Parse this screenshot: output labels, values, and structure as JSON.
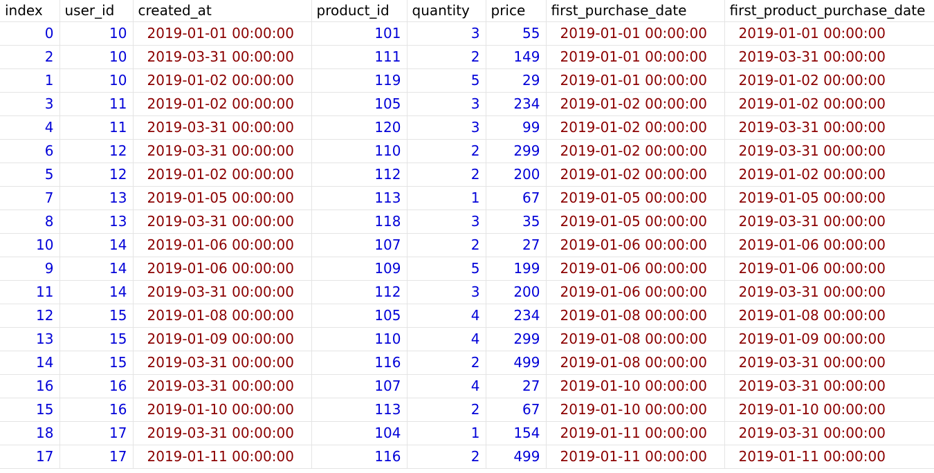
{
  "columns": [
    {
      "key": "index",
      "label": "index",
      "type": "num"
    },
    {
      "key": "user_id",
      "label": "user_id",
      "type": "num"
    },
    {
      "key": "created_at",
      "label": "created_at",
      "type": "date"
    },
    {
      "key": "product_id",
      "label": "product_id",
      "type": "num"
    },
    {
      "key": "quantity",
      "label": "quantity",
      "type": "num"
    },
    {
      "key": "price",
      "label": "price",
      "type": "num"
    },
    {
      "key": "first_purchase_date",
      "label": "first_purchase_date",
      "type": "date"
    },
    {
      "key": "first_product_purchase_date",
      "label": "first_product_purchase_date",
      "type": "date"
    }
  ],
  "rows": [
    [
      "0",
      "10",
      "2019-01-01 00:00:00",
      "101",
      "3",
      "55",
      "2019-01-01 00:00:00",
      "2019-01-01 00:00:00"
    ],
    [
      "2",
      "10",
      "2019-03-31 00:00:00",
      "111",
      "2",
      "149",
      "2019-01-01 00:00:00",
      "2019-03-31 00:00:00"
    ],
    [
      "1",
      "10",
      "2019-01-02 00:00:00",
      "119",
      "5",
      "29",
      "2019-01-01 00:00:00",
      "2019-01-02 00:00:00"
    ],
    [
      "3",
      "11",
      "2019-01-02 00:00:00",
      "105",
      "3",
      "234",
      "2019-01-02 00:00:00",
      "2019-01-02 00:00:00"
    ],
    [
      "4",
      "11",
      "2019-03-31 00:00:00",
      "120",
      "3",
      "99",
      "2019-01-02 00:00:00",
      "2019-03-31 00:00:00"
    ],
    [
      "6",
      "12",
      "2019-03-31 00:00:00",
      "110",
      "2",
      "299",
      "2019-01-02 00:00:00",
      "2019-03-31 00:00:00"
    ],
    [
      "5",
      "12",
      "2019-01-02 00:00:00",
      "112",
      "2",
      "200",
      "2019-01-02 00:00:00",
      "2019-01-02 00:00:00"
    ],
    [
      "7",
      "13",
      "2019-01-05 00:00:00",
      "113",
      "1",
      "67",
      "2019-01-05 00:00:00",
      "2019-01-05 00:00:00"
    ],
    [
      "8",
      "13",
      "2019-03-31 00:00:00",
      "118",
      "3",
      "35",
      "2019-01-05 00:00:00",
      "2019-03-31 00:00:00"
    ],
    [
      "10",
      "14",
      "2019-01-06 00:00:00",
      "107",
      "2",
      "27",
      "2019-01-06 00:00:00",
      "2019-01-06 00:00:00"
    ],
    [
      "9",
      "14",
      "2019-01-06 00:00:00",
      "109",
      "5",
      "199",
      "2019-01-06 00:00:00",
      "2019-01-06 00:00:00"
    ],
    [
      "11",
      "14",
      "2019-03-31 00:00:00",
      "112",
      "3",
      "200",
      "2019-01-06 00:00:00",
      "2019-03-31 00:00:00"
    ],
    [
      "12",
      "15",
      "2019-01-08 00:00:00",
      "105",
      "4",
      "234",
      "2019-01-08 00:00:00",
      "2019-01-08 00:00:00"
    ],
    [
      "13",
      "15",
      "2019-01-09 00:00:00",
      "110",
      "4",
      "299",
      "2019-01-08 00:00:00",
      "2019-01-09 00:00:00"
    ],
    [
      "14",
      "15",
      "2019-03-31 00:00:00",
      "116",
      "2",
      "499",
      "2019-01-08 00:00:00",
      "2019-03-31 00:00:00"
    ],
    [
      "16",
      "16",
      "2019-03-31 00:00:00",
      "107",
      "4",
      "27",
      "2019-01-10 00:00:00",
      "2019-03-31 00:00:00"
    ],
    [
      "15",
      "16",
      "2019-01-10 00:00:00",
      "113",
      "2",
      "67",
      "2019-01-10 00:00:00",
      "2019-01-10 00:00:00"
    ],
    [
      "18",
      "17",
      "2019-03-31 00:00:00",
      "104",
      "1",
      "154",
      "2019-01-11 00:00:00",
      "2019-03-31 00:00:00"
    ],
    [
      "17",
      "17",
      "2019-01-11 00:00:00",
      "116",
      "2",
      "499",
      "2019-01-11 00:00:00",
      "2019-01-11 00:00:00"
    ]
  ],
  "colors": {
    "number": "#0000d8",
    "date": "#8b0000",
    "header": "#000000",
    "gridline": "#e4e4e4"
  }
}
